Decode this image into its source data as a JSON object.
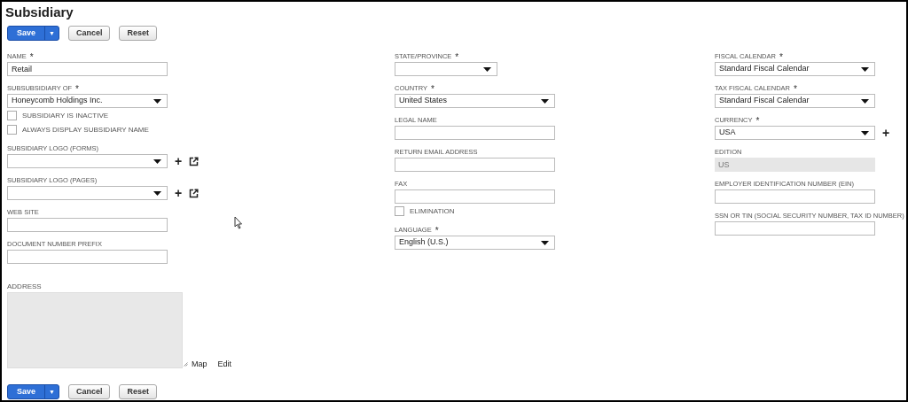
{
  "title": "Subsidiary",
  "top_buttons": [
    {
      "label": "Save",
      "kind": "primary",
      "caret": "▼"
    },
    {
      "label": "Cancel",
      "kind": "plain"
    },
    {
      "label": "Reset",
      "kind": "plain"
    }
  ],
  "columns": [
    [
      {
        "kind": "text",
        "label": "NAME",
        "marker": "*",
        "value": "Retail"
      },
      {
        "kind": "select",
        "label": "SUBSUBSIDIARY OF",
        "marker": "*",
        "value": "Honeycomb Holdings Inc."
      },
      {
        "kind": "checkbox",
        "label": "SUBSIDIARY IS INACTIVE",
        "checked": false
      },
      {
        "kind": "checkbox",
        "label": "ALWAYS DISPLAY SUBSIDIARY NAME",
        "checked": false
      },
      {
        "kind": "select",
        "label": "SUBSIDIARY LOGO (FORMS)",
        "add": "+",
        "open": true
      },
      {
        "kind": "select",
        "label": "SUBSIDIARY LOGO (PAGES)",
        "add": "+",
        "open": true
      },
      {
        "kind": "text",
        "label": "WEB SITE"
      },
      {
        "kind": "text",
        "label": "DOCUMENT NUMBER PREFIX"
      },
      {
        "kind": "address",
        "label": "ADDRESS",
        "links": [
          "Map",
          "Edit"
        ]
      }
    ],
    [
      {
        "kind": "short-select",
        "label": "STATE/PROVINCE",
        "marker": "*"
      },
      {
        "kind": "select",
        "label": "COUNTRY",
        "marker": "*",
        "value": "United States"
      },
      {
        "kind": "text",
        "label": "LEGAL NAME"
      },
      {
        "kind": "text",
        "label": "RETURN EMAIL ADDRESS"
      },
      {
        "kind": "text",
        "label": "FAX"
      },
      {
        "kind": "checkbox",
        "label": "ELIMINATION",
        "checked": false
      },
      {
        "kind": "select",
        "label": "LANGUAGE",
        "marker": "*",
        "value": "English (U.S.)"
      }
    ],
    [
      {
        "kind": "select",
        "label": "FISCAL CALENDAR",
        "marker": "*",
        "value": "Standard Fiscal Calendar"
      },
      {
        "kind": "select",
        "label": "TAX FISCAL CALENDAR",
        "marker": "*",
        "value": "Standard Fiscal Calendar"
      },
      {
        "kind": "select",
        "label": "CURRENCY",
        "marker": "*",
        "value": "USA",
        "add": "+"
      },
      {
        "kind": "readonly",
        "label": "EDITION",
        "value": "US"
      },
      {
        "kind": "text",
        "label": "EMPLOYER IDENTIFICATION NUMBER (EIN)"
      },
      {
        "kind": "text",
        "label": "SSN OR TIN (SOCIAL SECURITY NUMBER, TAX ID NUMBER)"
      }
    ]
  ],
  "bottom_buttons": [
    {
      "label": "Save",
      "kind": "primary",
      "caret": "▼"
    },
    {
      "label": "Cancel",
      "kind": "plain"
    },
    {
      "label": "Reset",
      "kind": "plain"
    }
  ]
}
